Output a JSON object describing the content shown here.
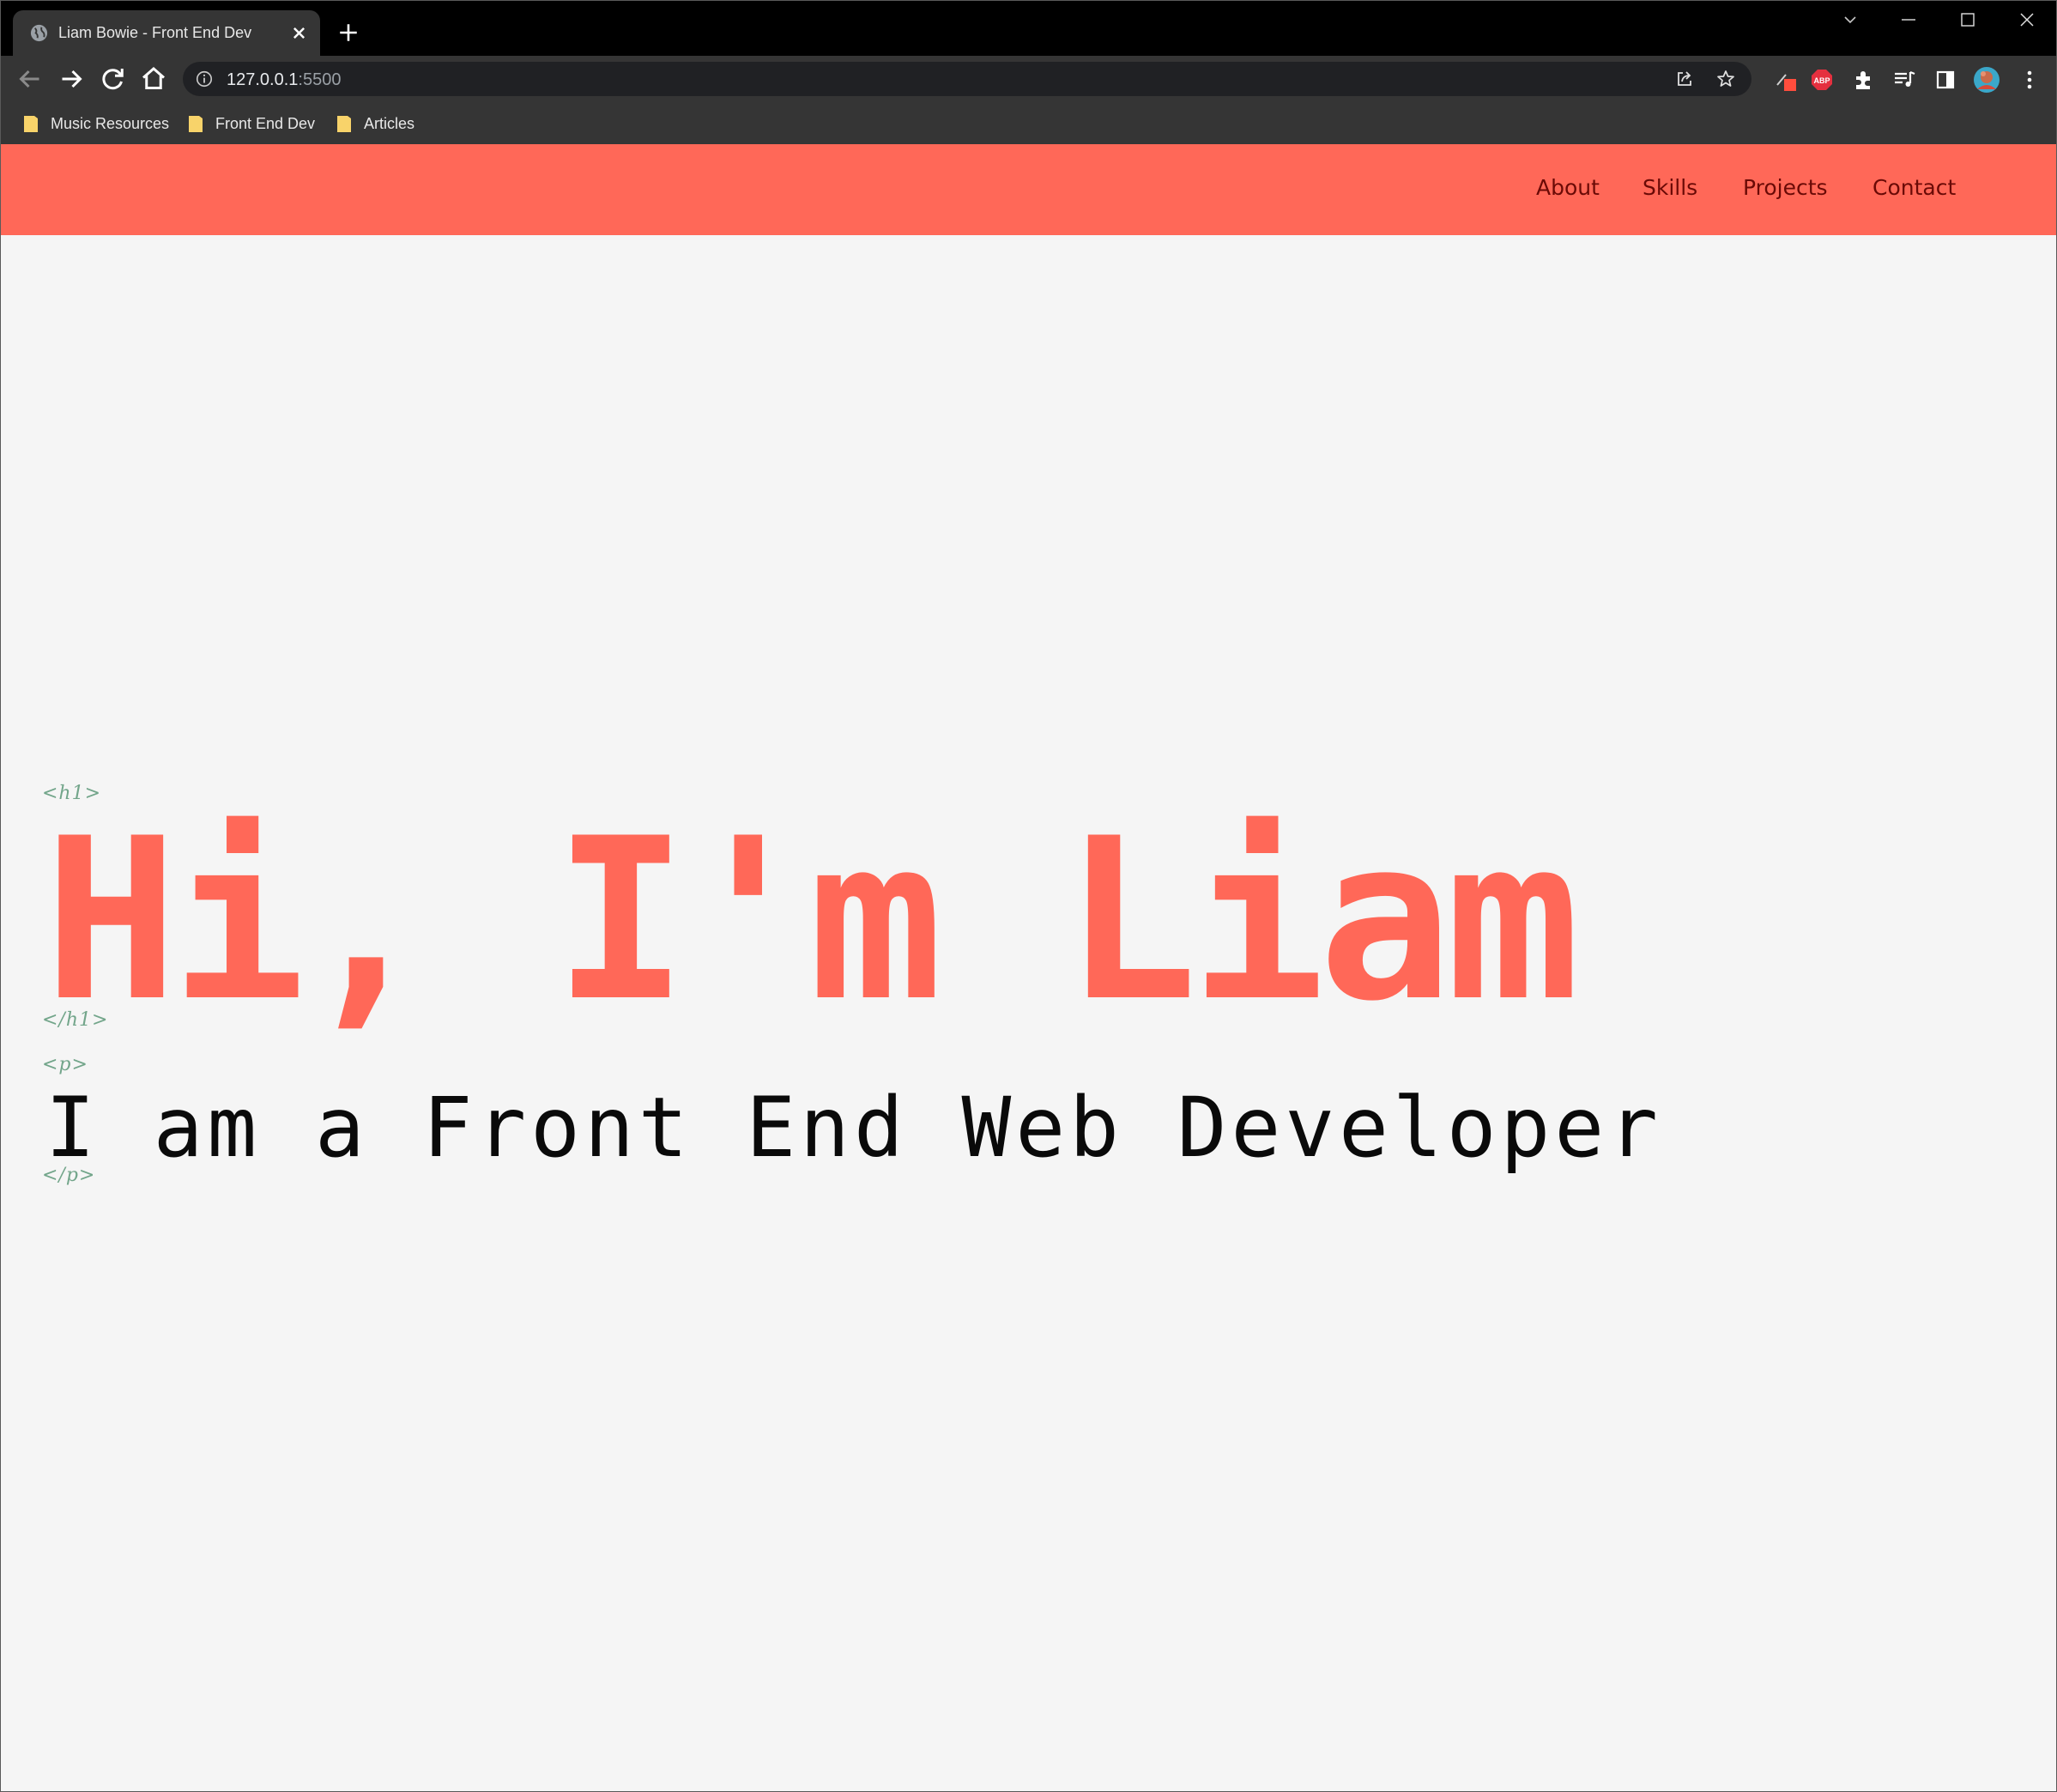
{
  "browser": {
    "tab": {
      "title": "Liam Bowie - Front End Dev",
      "favicon": "globe-icon"
    },
    "address_bar": {
      "host": "127.0.0.1",
      "port": ":5500",
      "security_icon": "info-icon"
    },
    "bookmarks": [
      {
        "label": "Music Resources",
        "icon": "folder-icon"
      },
      {
        "label": "Front End Dev",
        "icon": "folder-icon"
      },
      {
        "label": "Articles",
        "icon": "folder-icon"
      }
    ],
    "extensions": {
      "adblock_label": "ABP"
    },
    "colors": {
      "frame": "#000000",
      "toolbar": "#353535",
      "omnibox": "#202124"
    }
  },
  "site": {
    "nav": {
      "links": [
        "About",
        "Skills",
        "Projects",
        "Contact"
      ]
    },
    "hero": {
      "h1_open_tag": "<h1>",
      "title": "Hi, I'm Liam",
      "h1_close_tag": "</h1>",
      "p_open_tag": "<p>",
      "subtitle": "I am a Front End Web Developer",
      "p_close_tag": "</p>"
    },
    "colors": {
      "accent": "#ff6858",
      "nav_text": "#6a0a06",
      "tag_text": "#72a58a",
      "background": "#f5f5f5"
    }
  }
}
